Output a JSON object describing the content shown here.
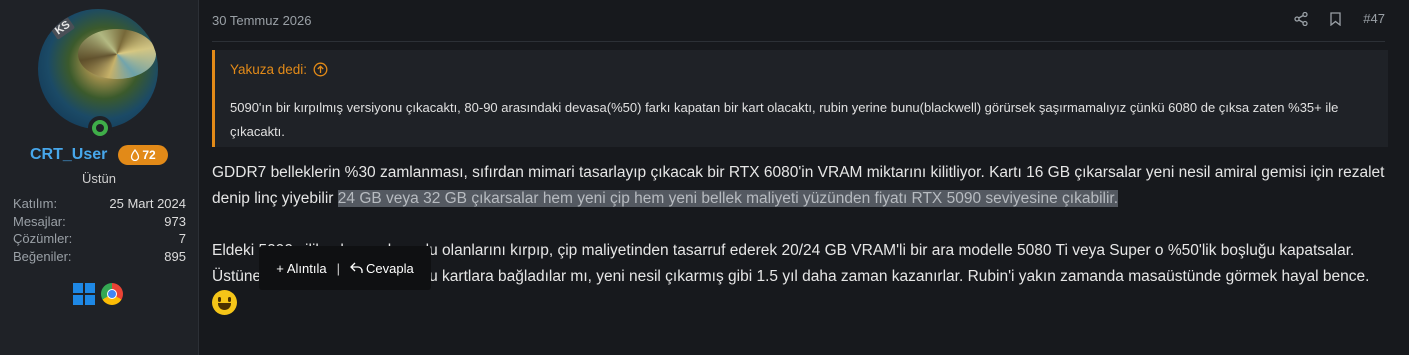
{
  "user": {
    "avatar_badge": "KS",
    "username": "CRT_User",
    "reputation": "72",
    "title": "Üstün",
    "stats": [
      {
        "label": "Katılım:",
        "value": "25 Mart 2024"
      },
      {
        "label": "Mesajlar:",
        "value": "973"
      },
      {
        "label": "Çözümler:",
        "value": "7"
      },
      {
        "label": "Beğeniler:",
        "value": "895"
      }
    ]
  },
  "post": {
    "date": "30 Temmuz 2026",
    "number": "#47",
    "quote": {
      "author_label": "Yakuza dedi:",
      "text": "5090'ın bir kırpılmış versiyonu çıkacaktı, 80-90 arasındaki devasa(%50) farkı kapatan bir kart olacaktı, rubin yerine bunu(blackwell) görürsek şaşırmamalıyız çünkü 6080 de çıksa zaten %35+ ile çıkacaktı."
    },
    "paragraph1_plain": "GDDR7 belleklerin %30 zamlanması, sıfırdan mimari tasarlayıp çıkacak bir RTX 6080'in VRAM miktarını kilitliyor. Kartı 16 GB çıkarsalar yeni nesil amiral gemisi için rezalet denip linç yiyebilir ",
    "paragraph1_selected": "24 GB veya 32 GB çıkarsalar hem yeni çip hem yeni bellek maliyeti yüzünden fiyatı RTX 5090 seviyesine çıkabilir.",
    "paragraph2": "Eldeki 5090 silikonlarının kusurlu olanlarını kırpıp, çip maliyetinden tasarruf ederek 20/24 GB VRAM'li bir ara modelle 5080 Ti veya Super o %50'lik boşluğu kapatsalar. Üstüne bir de DLSS 5 kozunu bu kartlara bağladılar mı, yeni nesil çıkarmış gibi 1.5 yıl daha zaman kazanırlar. Rubin'i yakın zamanda masaüstünde görmek hayal bence."
  },
  "selection_popup": {
    "quote_label": "Alıntıla",
    "separator": "|",
    "reply_label": "Cevapla"
  },
  "colors": {
    "accent": "#e28a18",
    "username": "#47a7eb",
    "background": "#17191d",
    "panel": "#1f2227"
  }
}
